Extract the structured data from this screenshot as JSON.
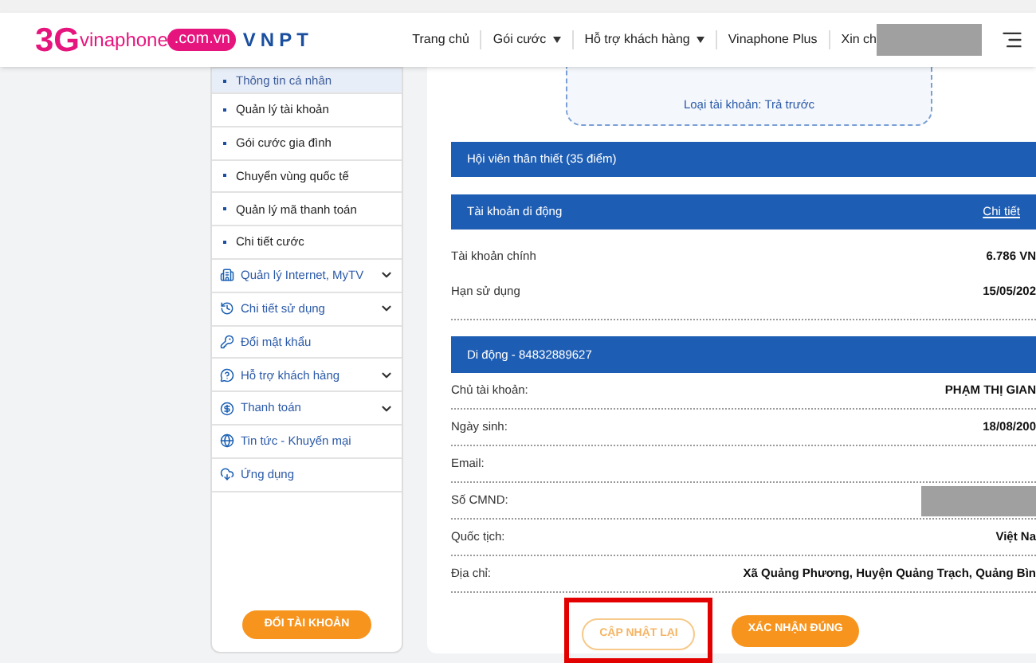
{
  "header": {
    "logo": {
      "prefix": "3G",
      "brand": "vinaphone",
      "domain": ".com.vn",
      "company": "VNPT"
    },
    "nav": [
      {
        "label": "Trang chủ",
        "dropdown": false
      },
      {
        "label": "Gói cước",
        "dropdown": true
      },
      {
        "label": "Hỗ trợ khách hàng",
        "dropdown": true
      },
      {
        "label": "Vinaphone Plus",
        "dropdown": false
      },
      {
        "label": "Xin ch",
        "dropdown": false
      }
    ],
    "redacted": true
  },
  "sidebar": {
    "items": [
      {
        "label": "Thông tin cá nhân",
        "kind": "bullet",
        "selected": true,
        "expandable": false
      },
      {
        "label": "Quản lý tài khoản",
        "kind": "bullet",
        "selected": false,
        "expandable": false
      },
      {
        "label": "Gói cước gia đình",
        "kind": "bullet",
        "selected": false,
        "expandable": false
      },
      {
        "label": "Chuyển vùng quốc tế",
        "kind": "bullet",
        "selected": false,
        "expandable": false
      },
      {
        "label": "Quản lý mã thanh toán",
        "kind": "bullet",
        "selected": false,
        "expandable": false
      },
      {
        "label": "Chi tiết cước",
        "kind": "bullet",
        "selected": false,
        "expandable": false
      },
      {
        "label": "Quản lý Internet, MyTV",
        "kind": "icon",
        "selected": false,
        "expandable": true
      },
      {
        "label": "Chi tiết sử dụng",
        "kind": "icon",
        "selected": false,
        "expandable": true
      },
      {
        "label": "Đổi mật khẩu",
        "kind": "icon",
        "selected": false,
        "expandable": false
      },
      {
        "label": "Hỗ trợ khách hàng",
        "kind": "icon",
        "selected": false,
        "expandable": true
      },
      {
        "label": "Thanh toán",
        "kind": "icon",
        "selected": false,
        "expandable": true
      },
      {
        "label": "Tin tức - Khuyến mại",
        "kind": "icon",
        "selected": false,
        "expandable": false
      },
      {
        "label": "Ứng dụng",
        "kind": "icon",
        "selected": false,
        "expandable": false
      }
    ],
    "switch_button": "ĐỔI TÀI KHOẢN"
  },
  "profile": {
    "account_type": "Loại tài khoản: Trả trước"
  },
  "membership": "Hội viên thân thiết (35 điểm)",
  "mobile_account": {
    "title": "Tài khoản di động",
    "link": "Chi tiết",
    "rows": [
      {
        "label": "Tài khoản chính",
        "value": "6.786 VN"
      },
      {
        "label": "Hạn sử dụng",
        "value": "15/05/202"
      }
    ]
  },
  "subscriber": {
    "title": "Di động - 84832889627",
    "rows": [
      {
        "label": "Chủ tài khoản:",
        "value": "PHẠM THỊ GIAN"
      },
      {
        "label": "Ngày sinh:",
        "value": "18/08/200"
      },
      {
        "label": "Email:"
      },
      {
        "label": "Số CMND:",
        "redacted": true
      },
      {
        "label": "Quốc tịch:",
        "value": "Việt Na"
      },
      {
        "label": "Địa chỉ:",
        "value": "Xã Quảng Phương, Huyện Quảng Trạch, Quảng Bìn"
      }
    ]
  },
  "actions": [
    {
      "label": "CẬP NHẬT LẠI",
      "kind": "outline",
      "highlighted": true
    },
    {
      "label": "XÁC NHẬN ĐÚNG",
      "kind": "filled",
      "highlighted": false
    }
  ]
}
